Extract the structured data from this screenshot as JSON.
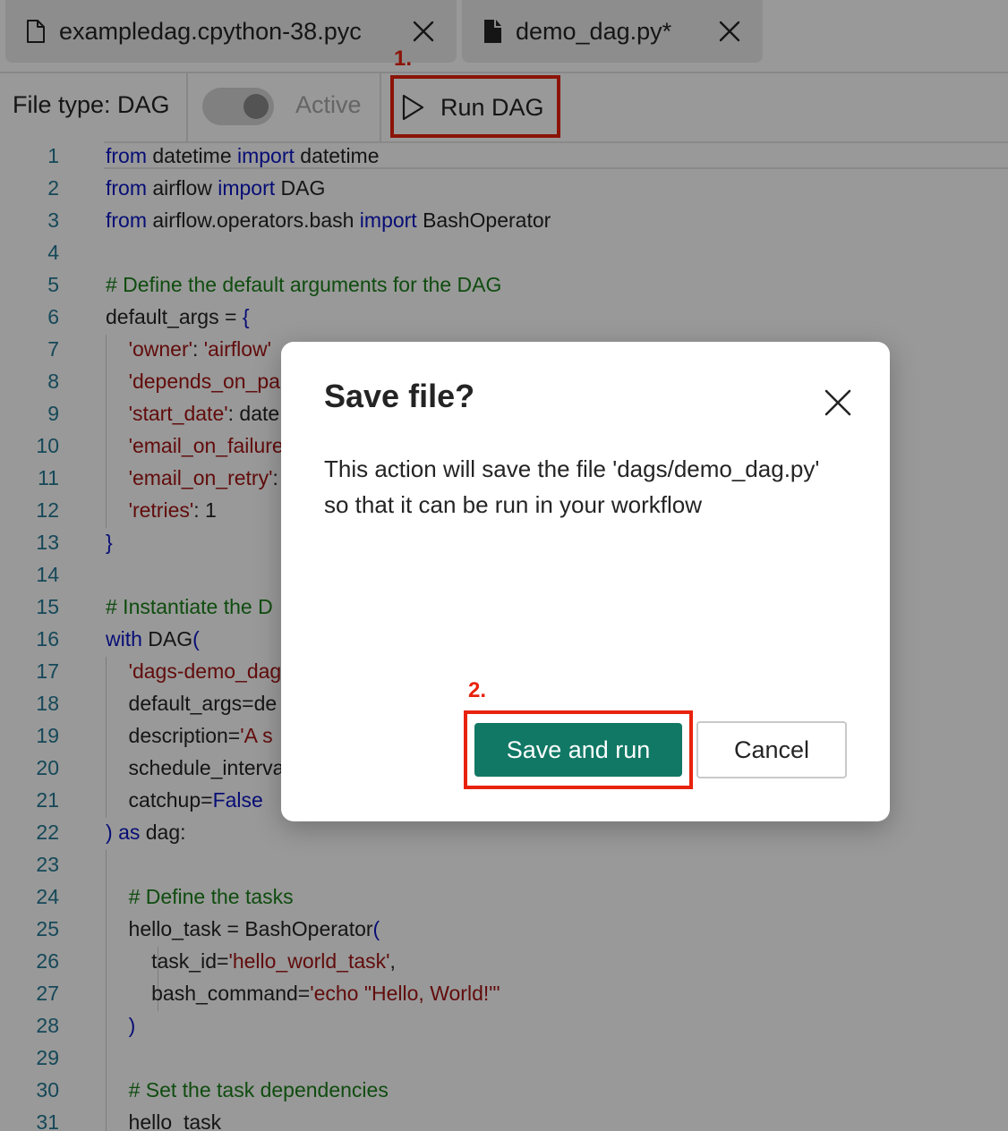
{
  "tabs": [
    {
      "label": "exampledag.cpython-38.pyc",
      "icon": "file-outline-icon"
    },
    {
      "label": "demo_dag.py*",
      "icon": "file-filled-icon"
    }
  ],
  "toolbar": {
    "file_type": "File type: DAG",
    "active_label": "Active",
    "run_label": "Run DAG"
  },
  "annotations": {
    "step1": "1.",
    "step2": "2."
  },
  "editor": {
    "line_numbers": [
      "1",
      "2",
      "3",
      "4",
      "5",
      "6",
      "7",
      "8",
      "9",
      "10",
      "11",
      "12",
      "13",
      "14",
      "15",
      "16",
      "17",
      "18",
      "19",
      "20",
      "21",
      "22",
      "23",
      "24",
      "25",
      "26",
      "27",
      "28",
      "29",
      "30",
      "31"
    ],
    "lines": [
      {
        "parts": [
          {
            "t": "from",
            "c": "kw"
          },
          {
            "t": " datetime "
          },
          {
            "t": "import",
            "c": "kw"
          },
          {
            "t": " datetime"
          }
        ]
      },
      {
        "parts": [
          {
            "t": "from",
            "c": "kw"
          },
          {
            "t": " airflow "
          },
          {
            "t": "import",
            "c": "kw"
          },
          {
            "t": " DAG"
          }
        ]
      },
      {
        "parts": [
          {
            "t": "from",
            "c": "kw"
          },
          {
            "t": " airflow.operators.bash "
          },
          {
            "t": "import",
            "c": "kw"
          },
          {
            "t": " BashOperator"
          }
        ]
      },
      {
        "parts": []
      },
      {
        "parts": [
          {
            "t": "# Define the default arguments for the DAG",
            "c": "cm"
          }
        ]
      },
      {
        "parts": [
          {
            "t": "default_args = "
          },
          {
            "t": "{",
            "c": "kw"
          }
        ]
      },
      {
        "parts": [
          {
            "t": "    "
          },
          {
            "t": "'owner'",
            "c": "str"
          },
          {
            "t": ": "
          },
          {
            "t": "'airflow'",
            "c": "str"
          }
        ]
      },
      {
        "parts": [
          {
            "t": "    "
          },
          {
            "t": "'depends_on_pa",
            "c": "str"
          }
        ]
      },
      {
        "parts": [
          {
            "t": "    "
          },
          {
            "t": "'start_date'",
            "c": "str"
          },
          {
            "t": ": date"
          }
        ]
      },
      {
        "parts": [
          {
            "t": "    "
          },
          {
            "t": "'email_on_failure",
            "c": "str"
          }
        ]
      },
      {
        "parts": [
          {
            "t": "    "
          },
          {
            "t": "'email_on_retry'",
            "c": "str"
          },
          {
            "t": ":"
          }
        ]
      },
      {
        "parts": [
          {
            "t": "    "
          },
          {
            "t": "'retries'",
            "c": "str"
          },
          {
            "t": ": 1"
          }
        ]
      },
      {
        "parts": [
          {
            "t": "}",
            "c": "kw"
          }
        ]
      },
      {
        "parts": []
      },
      {
        "parts": [
          {
            "t": "# Instantiate the D",
            "c": "cm"
          }
        ]
      },
      {
        "parts": [
          {
            "t": "with",
            "c": "kw"
          },
          {
            "t": " DAG"
          },
          {
            "t": "(",
            "c": "kw"
          }
        ]
      },
      {
        "parts": [
          {
            "t": "    "
          },
          {
            "t": "'dags-demo_dag",
            "c": "str"
          }
        ]
      },
      {
        "parts": [
          {
            "t": "    default_args=de"
          }
        ]
      },
      {
        "parts": [
          {
            "t": "    description="
          },
          {
            "t": "'A s",
            "c": "str"
          }
        ]
      },
      {
        "parts": [
          {
            "t": "    schedule_interva"
          }
        ]
      },
      {
        "parts": [
          {
            "t": "    catchup="
          },
          {
            "t": "False",
            "c": "kw"
          }
        ]
      },
      {
        "parts": [
          {
            "t": ")",
            "c": "kw"
          },
          {
            "t": " "
          },
          {
            "t": "as",
            "c": "kw"
          },
          {
            "t": " dag:"
          }
        ]
      },
      {
        "parts": []
      },
      {
        "parts": [
          {
            "t": "    "
          },
          {
            "t": "# Define the tasks",
            "c": "cm"
          }
        ]
      },
      {
        "parts": [
          {
            "t": "    hello_task = BashOperator"
          },
          {
            "t": "(",
            "c": "kw"
          }
        ]
      },
      {
        "parts": [
          {
            "t": "        task_id="
          },
          {
            "t": "'hello_world_task'",
            "c": "str"
          },
          {
            "t": ","
          }
        ]
      },
      {
        "parts": [
          {
            "t": "        bash_command="
          },
          {
            "t": "'echo \"Hello, World!\"'",
            "c": "str"
          }
        ]
      },
      {
        "parts": [
          {
            "t": "    "
          },
          {
            "t": ")",
            "c": "kw"
          }
        ]
      },
      {
        "parts": []
      },
      {
        "parts": [
          {
            "t": "    "
          },
          {
            "t": "# Set the task dependencies",
            "c": "cm"
          }
        ]
      },
      {
        "parts": [
          {
            "t": "    hello_task"
          }
        ]
      }
    ]
  },
  "dialog": {
    "title": "Save file?",
    "body": "This action will save the file 'dags/demo_dag.py' so that it can be run in your workflow",
    "primary": "Save and run",
    "secondary": "Cancel",
    "close_icon": "close-icon"
  },
  "colors": {
    "keyword": "#0b16c4",
    "string": "#a31515",
    "comment": "#1a7f1a",
    "line_number": "#237893",
    "primary_button": "#117865",
    "annotation": "#e8220c"
  }
}
